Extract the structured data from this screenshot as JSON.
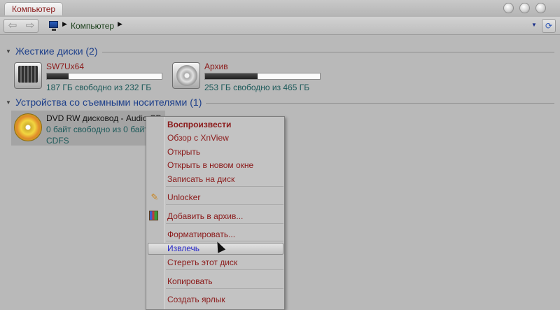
{
  "window": {
    "title": "Компьютер"
  },
  "toolbar": {
    "back_icon": "back-arrow-icon",
    "forward_icon": "forward-arrow-icon",
    "breadcrumb_label": "Компьютер",
    "refresh_icon": "refresh-icon"
  },
  "groups": {
    "hard_disks": {
      "title": "Жесткие диски (2)",
      "drives": [
        {
          "name": "SW7Ux64",
          "free_text": "187 ГБ свободно из 232 ГБ",
          "used_fraction": 0.19
        },
        {
          "name": "Архив",
          "free_text": "253 ГБ свободно из 465 ГБ",
          "used_fraction": 0.46
        }
      ]
    },
    "removable": {
      "title": "Устройства со съемными носителями (1)",
      "device": {
        "name": "DVD RW дисковод - Audio CD",
        "free_text": "0 байт свободно из 0 байт",
        "fs": "CDFS"
      }
    }
  },
  "context_menu": {
    "items": [
      {
        "label": "Воспроизвести"
      },
      {
        "label": "Обзор с XnView"
      },
      {
        "label": "Открыть"
      },
      {
        "label": "Открыть в новом окне"
      },
      {
        "label": "Записать на диск"
      },
      {
        "label": "Unlocker",
        "icon": "unlocker-wand-icon"
      },
      {
        "label": "Добавить в архив...",
        "icon": "winrar-archive-icon"
      },
      {
        "label": "Форматировать..."
      },
      {
        "label": "Извлечь"
      },
      {
        "label": "Стереть этот диск"
      },
      {
        "label": "Копировать"
      },
      {
        "label": "Создать ярлык"
      }
    ]
  }
}
